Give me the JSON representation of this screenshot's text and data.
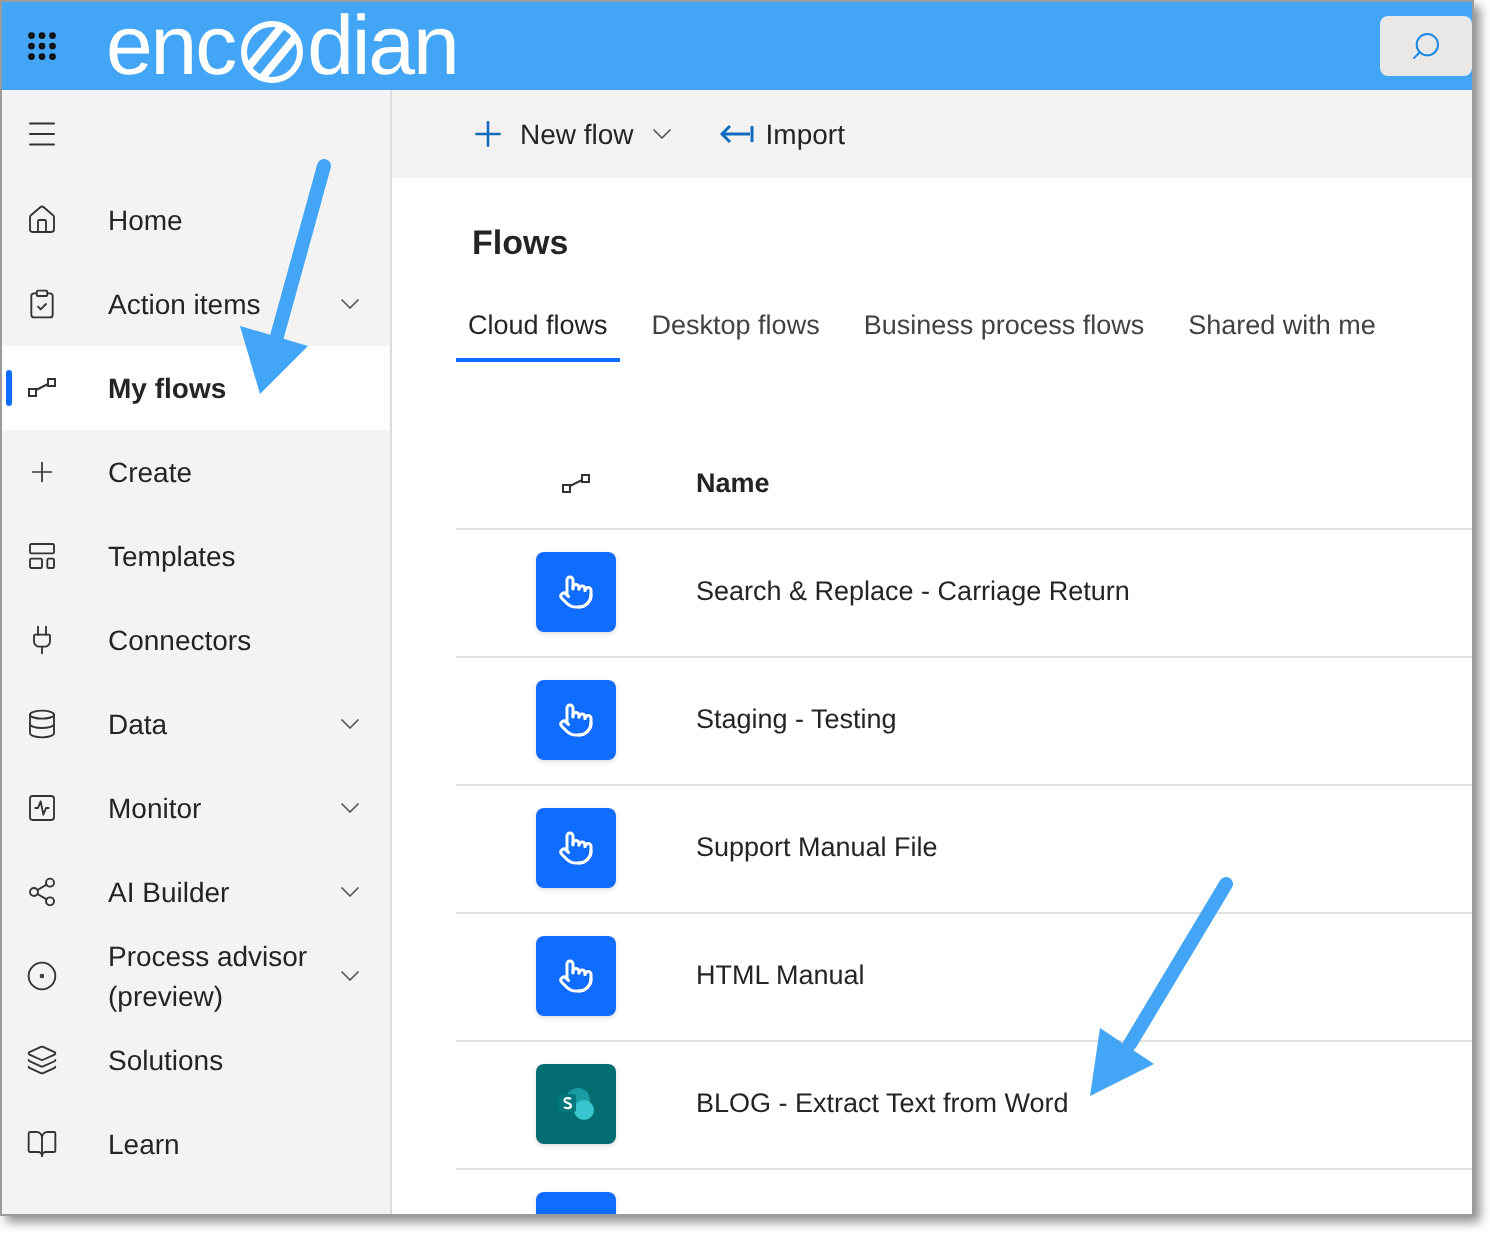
{
  "header": {
    "logo_start": "enc",
    "logo_end": "dian"
  },
  "toolbar": {
    "buttons": [
      {
        "label": "New flow",
        "kind": "new"
      },
      {
        "label": "Import",
        "kind": "import"
      }
    ]
  },
  "sidebar": {
    "items": [
      {
        "label": "Home",
        "selected": false,
        "expandable": false
      },
      {
        "label": "Action items",
        "selected": false,
        "expandable": true
      },
      {
        "label": "My flows",
        "selected": true,
        "expandable": false
      },
      {
        "label": "Create",
        "selected": false,
        "expandable": false
      },
      {
        "label": "Templates",
        "selected": false,
        "expandable": false
      },
      {
        "label": "Connectors",
        "selected": false,
        "expandable": false
      },
      {
        "label": "Data",
        "selected": false,
        "expandable": true
      },
      {
        "label": "Monitor",
        "selected": false,
        "expandable": true
      },
      {
        "label": "AI Builder",
        "selected": false,
        "expandable": true
      },
      {
        "label": "Process advisor (preview)",
        "selected": false,
        "expandable": true
      },
      {
        "label": "Solutions",
        "selected": false,
        "expandable": false
      },
      {
        "label": "Learn",
        "selected": false,
        "expandable": false
      }
    ]
  },
  "page": {
    "title": "Flows"
  },
  "tabs": [
    {
      "label": "Cloud flows",
      "selected": true
    },
    {
      "label": "Desktop flows",
      "selected": false
    },
    {
      "label": "Business process flows",
      "selected": false
    },
    {
      "label": "Shared with me",
      "selected": false
    }
  ],
  "table": {
    "columns": [
      "Name"
    ],
    "rows": [
      {
        "kind": "button",
        "name": "Search & Replace - Carriage Return"
      },
      {
        "kind": "button",
        "name": "Staging - Testing"
      },
      {
        "kind": "button",
        "name": "Support Manual File"
      },
      {
        "kind": "button",
        "name": "HTML Manual"
      },
      {
        "kind": "sharepoint",
        "name": "BLOG - Extract Text from Word"
      },
      {
        "kind": "button"
      }
    ]
  }
}
